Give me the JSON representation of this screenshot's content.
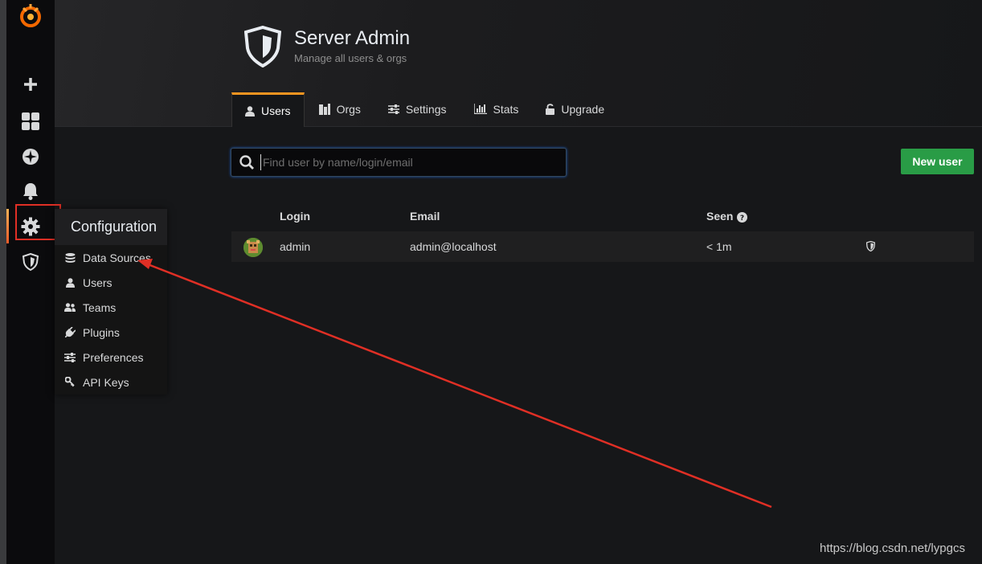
{
  "header": {
    "title": "Server Admin",
    "subtitle": "Manage all users & orgs"
  },
  "tabs": [
    {
      "label": "Users",
      "icon": "user-icon",
      "active": true
    },
    {
      "label": "Orgs",
      "icon": "building-icon",
      "active": false
    },
    {
      "label": "Settings",
      "icon": "sliders-icon",
      "active": false
    },
    {
      "label": "Stats",
      "icon": "bar-chart-icon",
      "active": false
    },
    {
      "label": "Upgrade",
      "icon": "unlock-icon",
      "active": false
    }
  ],
  "search": {
    "placeholder": "Find user by name/login/email",
    "value": ""
  },
  "new_user_label": "New user",
  "table": {
    "headers": {
      "login": "Login",
      "email": "Email",
      "seen": "Seen"
    },
    "rows": [
      {
        "login": "admin",
        "email": "admin@localhost",
        "seen": "< 1m",
        "is_admin": true
      }
    ]
  },
  "sidemenu": {
    "items": [
      "grafana-logo",
      "plus-icon",
      "dashboards-icon",
      "explore-icon",
      "bell-icon",
      "gear-icon",
      "shield-icon"
    ]
  },
  "config_menu": {
    "title": "Configuration",
    "items": [
      {
        "label": "Data Sources",
        "icon": "database-icon"
      },
      {
        "label": "Users",
        "icon": "user-icon"
      },
      {
        "label": "Teams",
        "icon": "users-icon"
      },
      {
        "label": "Plugins",
        "icon": "plug-icon"
      },
      {
        "label": "Preferences",
        "icon": "sliders-icon"
      },
      {
        "label": "API Keys",
        "icon": "key-icon"
      }
    ]
  },
  "watermark": "https://blog.csdn.net/lypgcs",
  "colors": {
    "accent": "#f79520",
    "primary_button": "#299c46",
    "annotation": "#e02f25"
  }
}
